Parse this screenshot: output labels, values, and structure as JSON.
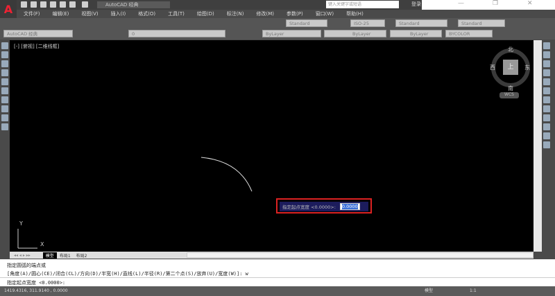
{
  "title": {
    "workspace": "AutoCAD 经典",
    "search_placeholder": "键入关键字或短语",
    "login": "登录"
  },
  "menu": [
    "文件(F)",
    "编辑(E)",
    "视图(V)",
    "插入(I)",
    "格式(O)",
    "工具(T)",
    "绘图(D)",
    "标注(N)",
    "修改(M)",
    "参数(P)",
    "窗口(W)",
    "帮助(H)"
  ],
  "toolbar": {
    "workspace_combo": "AutoCAD 经典",
    "layer": "0",
    "text_style": "Standard",
    "dim_style": "ISO-25",
    "table_style": "Standard",
    "mleader_style": "Standard",
    "color": "ByLayer",
    "linetype": "ByLayer",
    "lineweight": "ByLayer",
    "plotstyle": "BYCOLOR"
  },
  "viewport": {
    "label": "[-] [俯视] [二维线框]",
    "compass": {
      "north": "北",
      "south": "南",
      "east": "东",
      "west": "西",
      "top": "上",
      "wcs": "WCS"
    },
    "ucs_x": "X",
    "ucs_y": "Y"
  },
  "dynamic_input": {
    "prompt": "指定起点宽度 <0.0000>:",
    "value": "0.0000"
  },
  "tabs": [
    "模型",
    "布局1",
    "布局2"
  ],
  "command": {
    "line1": "指定圆弧的端点或",
    "line2": "[角度(A)/圆心(CE)/闭合(CL)/方向(D)/半宽(H)/直线(L)/半径(R)/第二个点(S)/放弃(U)/宽度(W)]: w",
    "prompt": "指定起点宽度 <0.0000>:"
  },
  "status": {
    "coords": "1419.4316, 311.9140 , 0.0000",
    "model": "模型",
    "scale": "1:1"
  },
  "colors": {
    "canvas": "#000000",
    "highlight": "#dd2222",
    "dyn_bg": "#1c1c5c"
  }
}
